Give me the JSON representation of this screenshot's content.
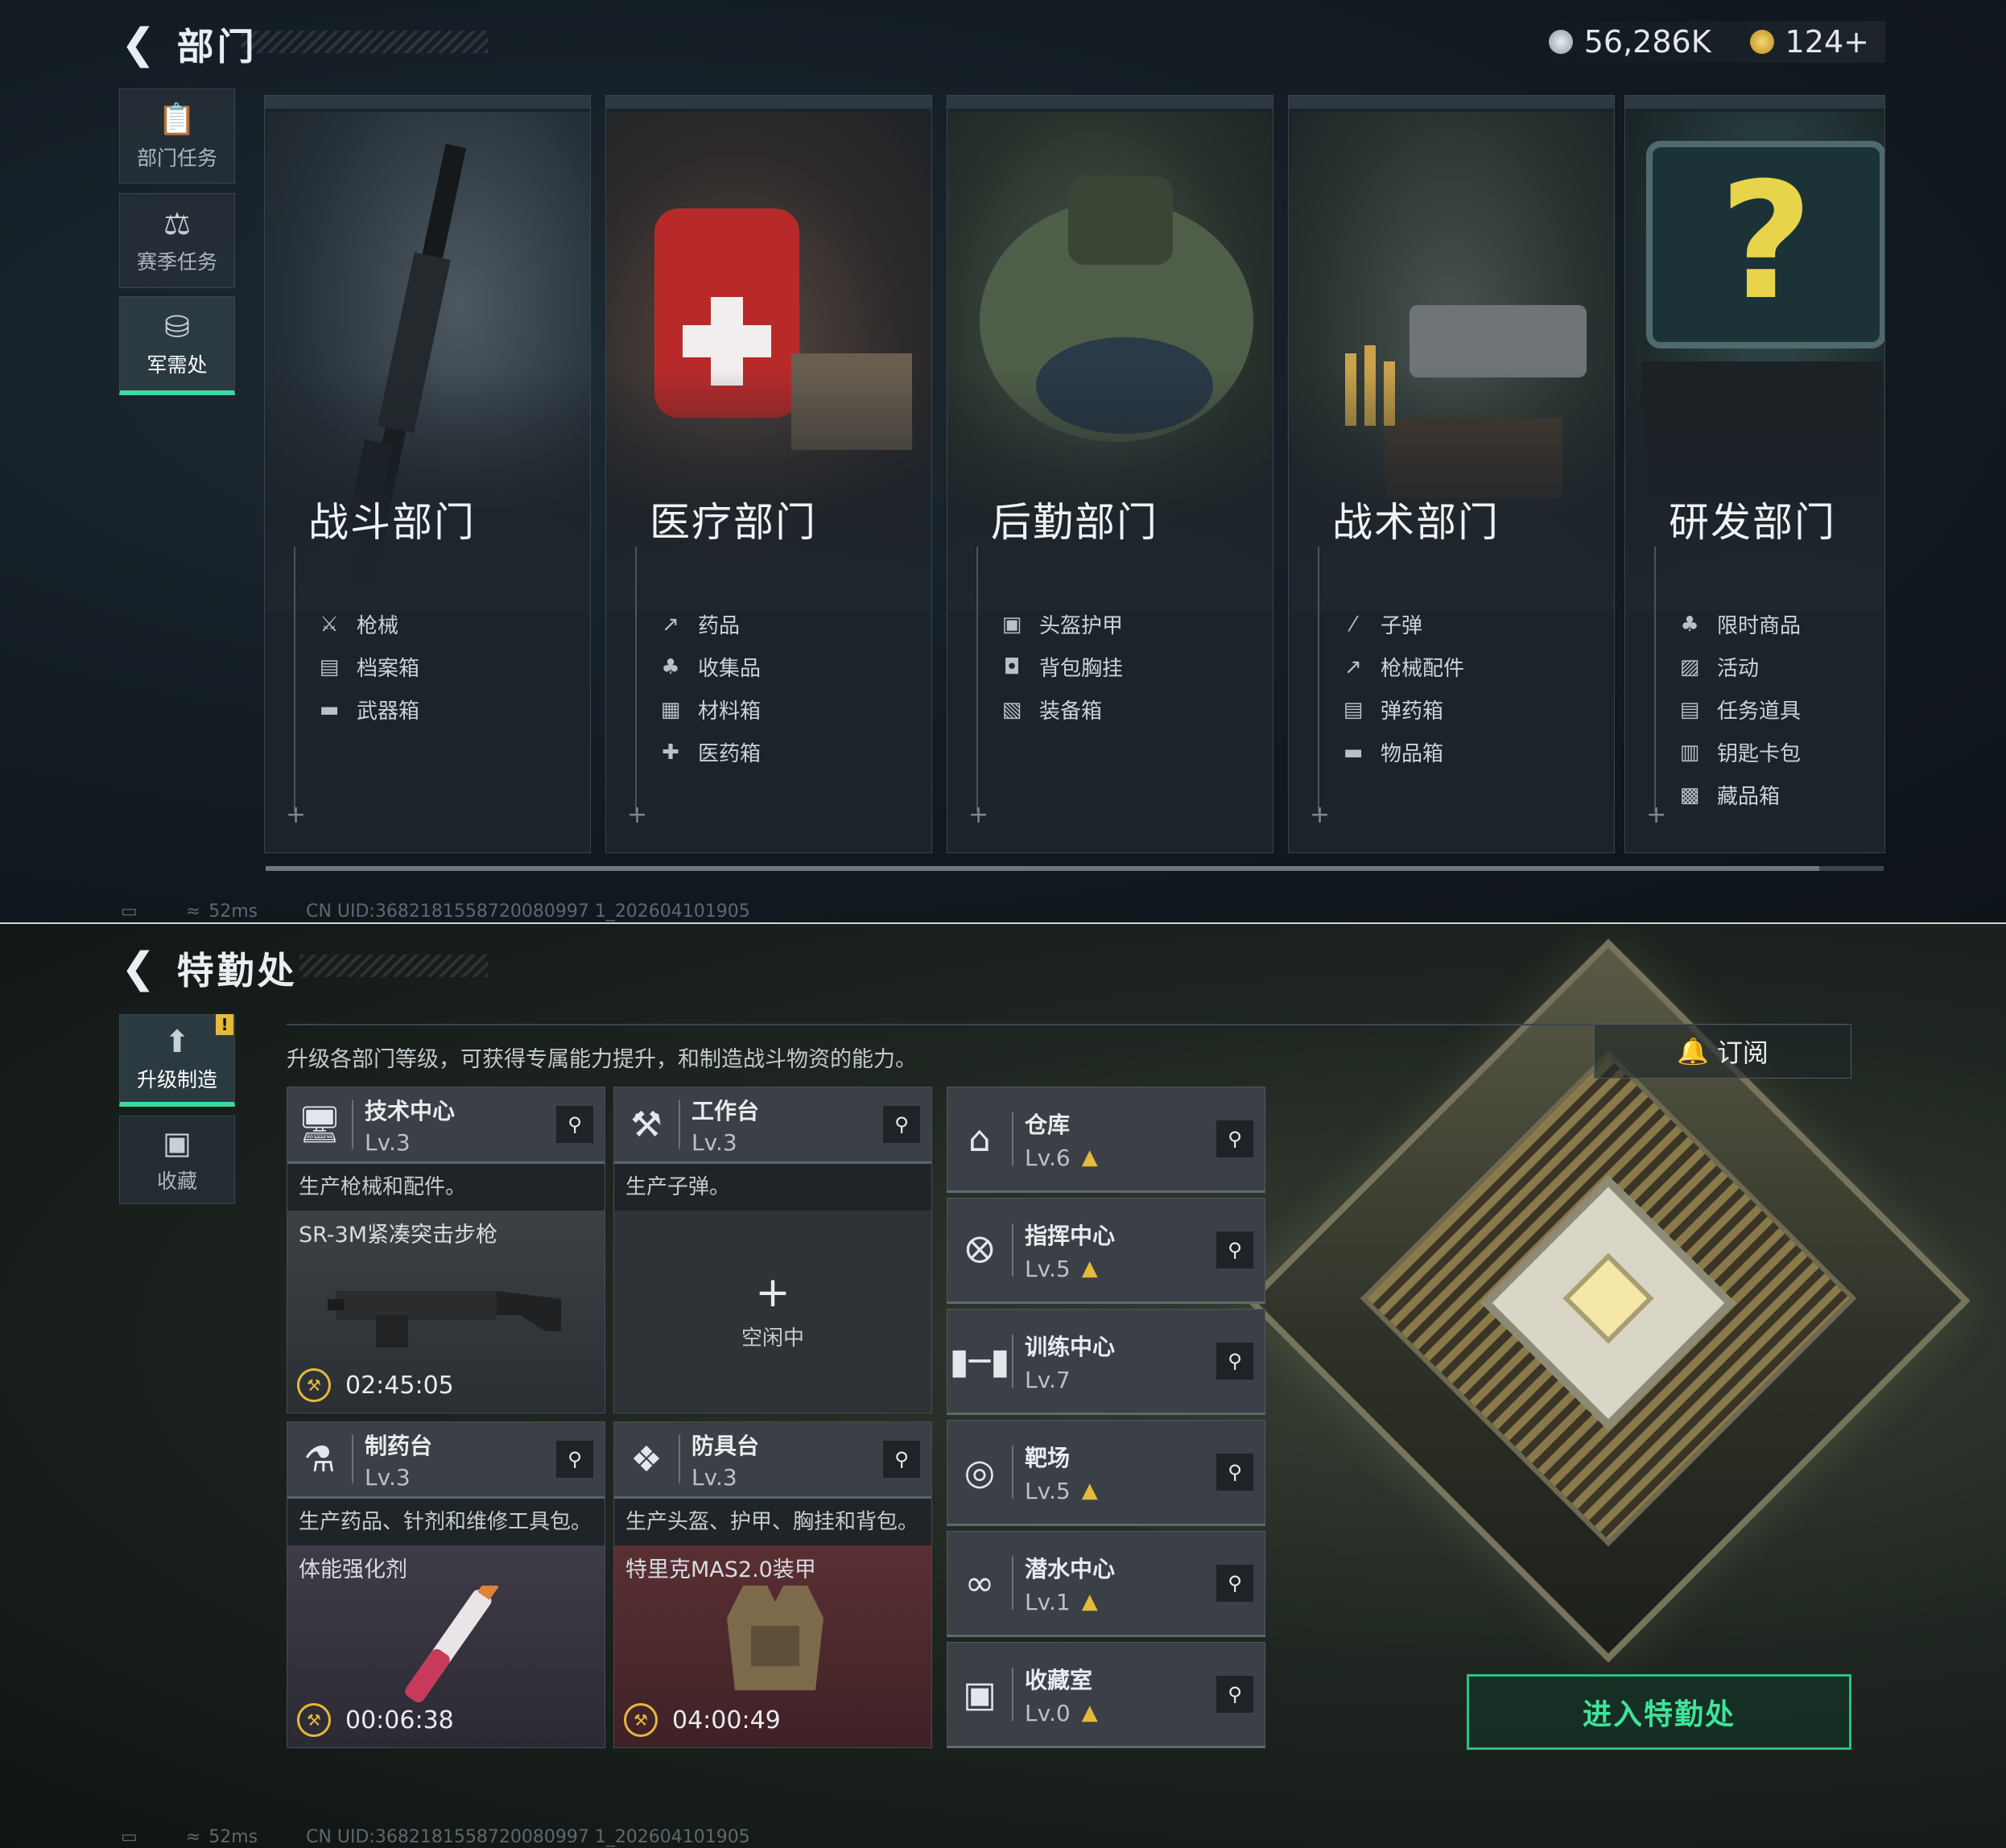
{
  "top": {
    "title": "部门",
    "back_icon": "back-arrow-icon",
    "currency": {
      "silver": "56,286K",
      "gold": "124+"
    },
    "sidebar": [
      {
        "label": "部门任务",
        "icon": "task-icon"
      },
      {
        "label": "赛季任务",
        "icon": "season-icon"
      },
      {
        "label": "军需处",
        "icon": "coins-icon",
        "active": true
      }
    ],
    "departments": [
      {
        "name": "战斗部门",
        "items": [
          {
            "label": "枪械",
            "icon": "rifle-icon"
          },
          {
            "label": "档案箱",
            "icon": "file-box-icon"
          },
          {
            "label": "武器箱",
            "icon": "weapon-case-icon"
          }
        ]
      },
      {
        "name": "医疗部门",
        "items": [
          {
            "label": "药品",
            "icon": "syringe-icon"
          },
          {
            "label": "收集品",
            "icon": "collectible-icon"
          },
          {
            "label": "材料箱",
            "icon": "material-box-icon"
          },
          {
            "label": "医药箱",
            "icon": "medkit-icon"
          }
        ]
      },
      {
        "name": "后勤部门",
        "items": [
          {
            "label": "头盔护甲",
            "icon": "armor-icon"
          },
          {
            "label": "背包胸挂",
            "icon": "backpack-icon"
          },
          {
            "label": "装备箱",
            "icon": "gear-box-icon"
          }
        ]
      },
      {
        "name": "战术部门",
        "items": [
          {
            "label": "子弹",
            "icon": "bullet-icon"
          },
          {
            "label": "枪械配件",
            "icon": "attachment-icon"
          },
          {
            "label": "弹药箱",
            "icon": "ammo-box-icon"
          },
          {
            "label": "物品箱",
            "icon": "item-box-icon"
          }
        ]
      },
      {
        "name": "研发部门",
        "items": [
          {
            "label": "限时商品",
            "icon": "limited-icon"
          },
          {
            "label": "活动",
            "icon": "event-icon"
          },
          {
            "label": "任务道具",
            "icon": "quest-item-icon"
          },
          {
            "label": "钥匙卡包",
            "icon": "keycard-icon"
          },
          {
            "label": "藏品箱",
            "icon": "collection-box-icon"
          }
        ]
      }
    ],
    "status": {
      "ping": "52ms",
      "uid": "CN UID:3682181558720080997 1_202604101905"
    }
  },
  "bottom": {
    "title": "特勤处",
    "subtitle": "升级各部门等级，可获得专属能力提升，和制造战斗物资的能力。",
    "subscribe_label": "订阅",
    "enter_label": "进入特勤处",
    "sidebar": [
      {
        "label": "升级制造",
        "icon": "upgrade-icon",
        "active": true,
        "badge": "!"
      },
      {
        "label": "收藏",
        "icon": "collection-icon"
      }
    ],
    "production": [
      {
        "name": "技术中心",
        "level": "Lv.3",
        "icon": "monitor-icon",
        "desc": "生产枪械和配件。",
        "item": "SR-3M紧凑突击步枪",
        "timer": "02:45:05"
      },
      {
        "name": "工作台",
        "level": "Lv.3",
        "icon": "tools-icon",
        "desc": "生产子弹。",
        "idle": "空闲中"
      },
      {
        "name": "制药台",
        "level": "Lv.3",
        "icon": "microscope-icon",
        "desc": "生产药品、针剂和维修工具包。",
        "item": "体能强化剂",
        "timer": "00:06:38"
      },
      {
        "name": "防具台",
        "level": "Lv.3",
        "icon": "blocks-icon",
        "desc": "生产头盔、护甲、胸挂和背包。",
        "item": "特里克MAS2.0装甲",
        "timer": "04:00:49"
      }
    ],
    "facilities": [
      {
        "name": "仓库",
        "level": "Lv.6",
        "icon": "warehouse-icon"
      },
      {
        "name": "指挥中心",
        "level": "Lv.5",
        "icon": "command-icon"
      },
      {
        "name": "训练中心",
        "level": "Lv.7",
        "icon": "dumbbell-icon"
      },
      {
        "name": "靶场",
        "level": "Lv.5",
        "icon": "target-icon"
      },
      {
        "name": "潜水中心",
        "level": "Lv.1",
        "icon": "diving-mask-icon"
      },
      {
        "name": "收藏室",
        "level": "Lv.0",
        "icon": "vault-icon"
      }
    ],
    "status": {
      "ping": "52ms",
      "uid": "CN UID:3682181558720080997 1_202604101905"
    }
  },
  "colors": {
    "accent": "#3cd9a0",
    "gold": "#e5b93b",
    "panel": "#3a4046"
  }
}
